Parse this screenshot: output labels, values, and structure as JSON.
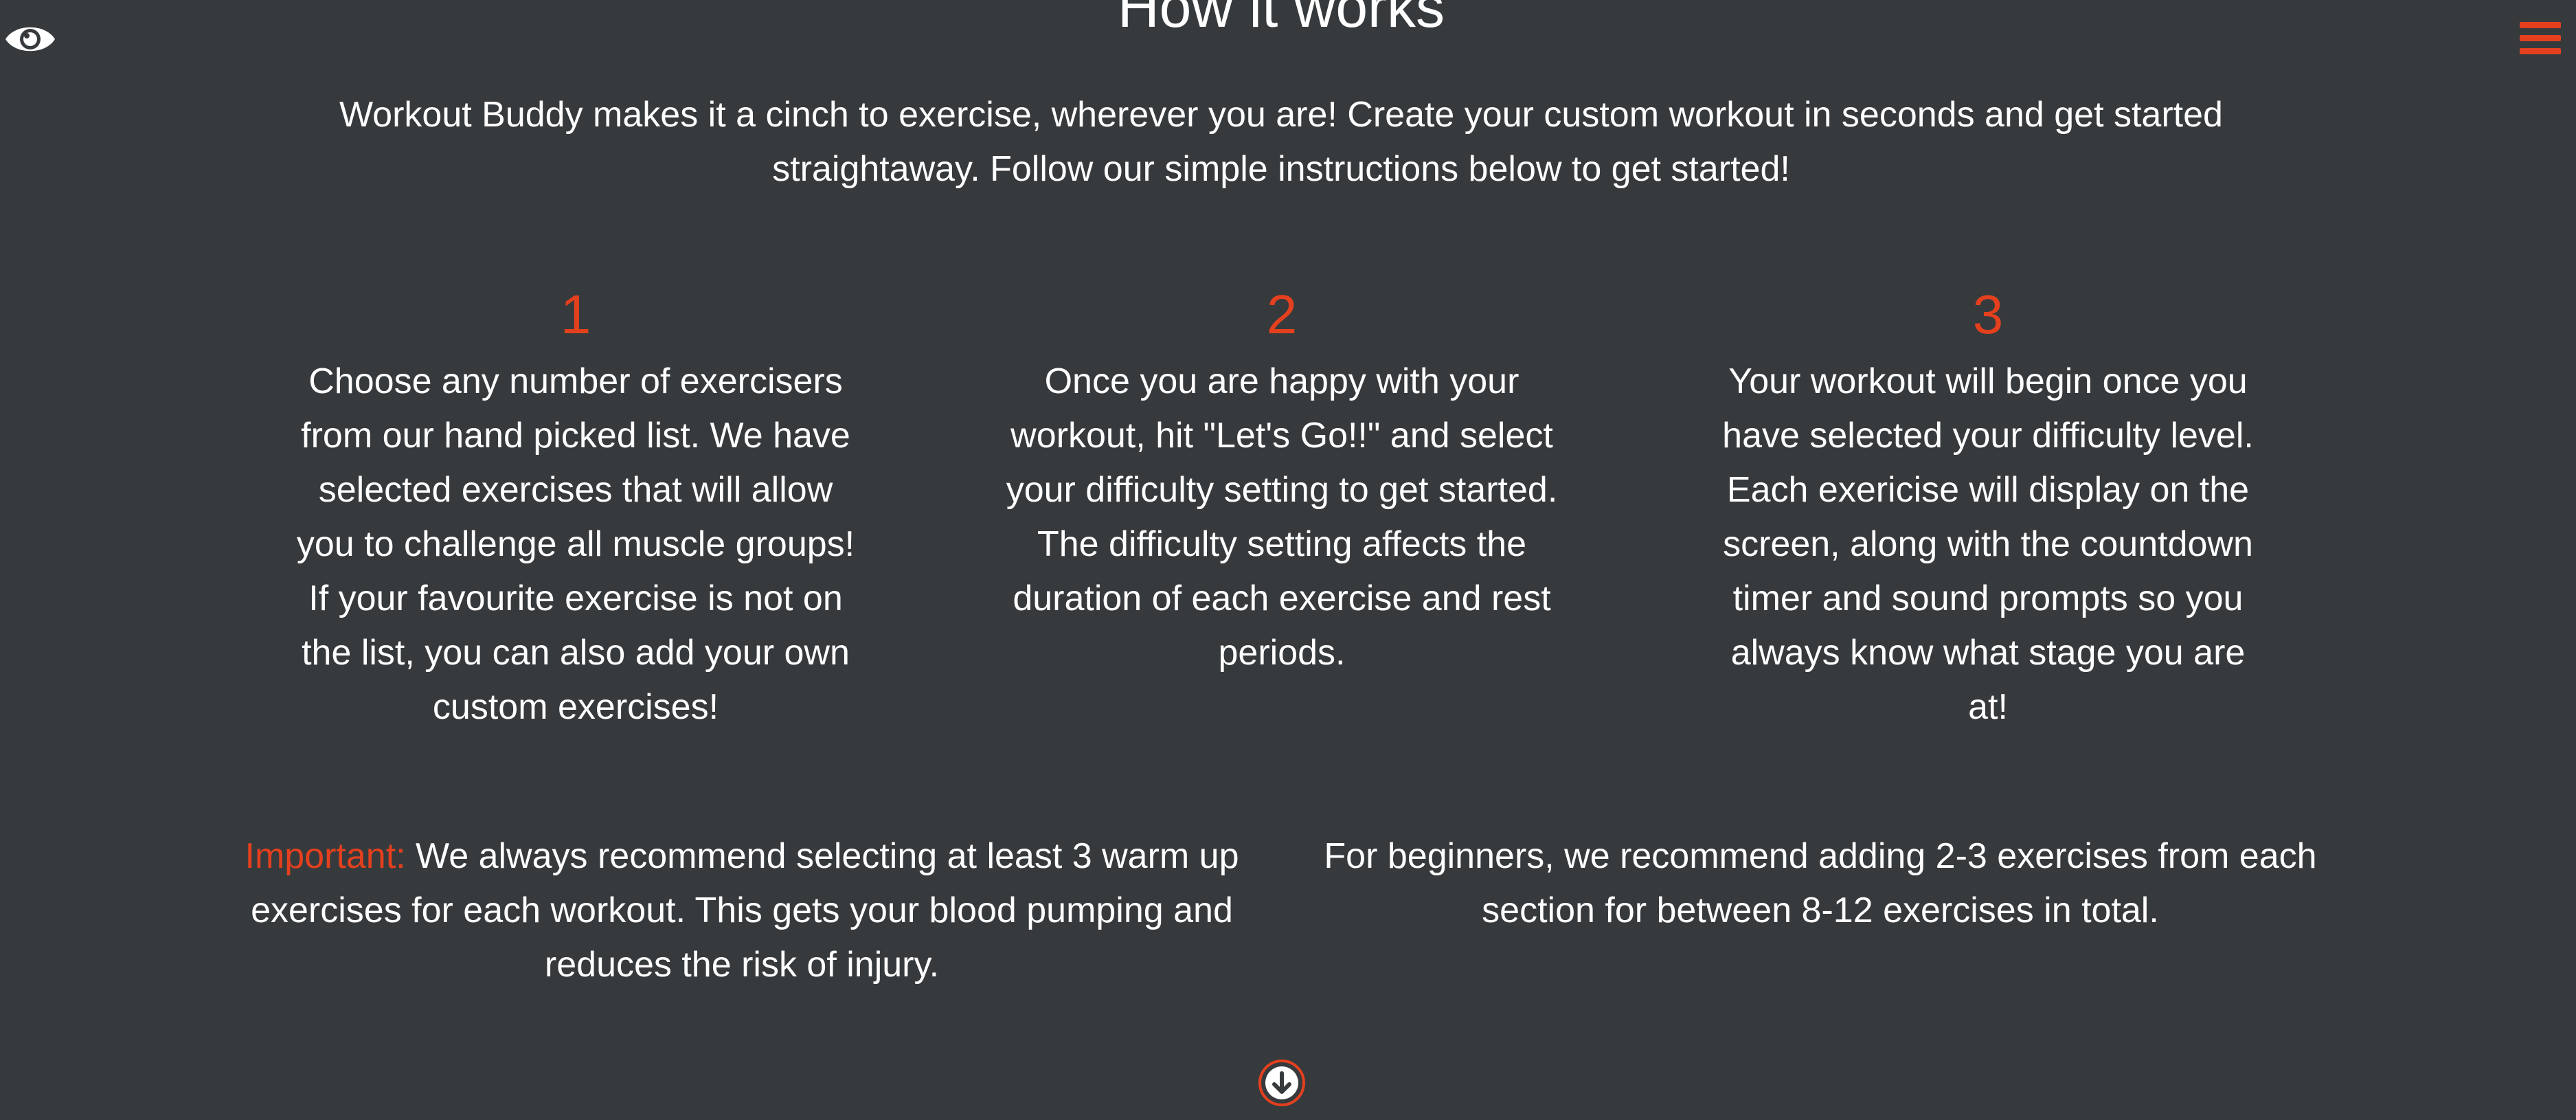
{
  "header": {
    "eye_icon": "eye-icon",
    "menu_icon": "hamburger-menu-icon"
  },
  "section": {
    "title": "How it works",
    "intro": "Workout Buddy makes it a cinch to exercise, wherever you are! Create your custom workout in seconds and get started straightaway. Follow our simple instructions below to get started!"
  },
  "steps": [
    {
      "number": "1",
      "text": "Choose any number of exercisers from our hand picked list. We have selected exercises that will allow you to challenge all muscle groups! If your favourite exercise is not on the list, you can also add your own custom exercises!"
    },
    {
      "number": "2",
      "text": "Once you are happy with your workout, hit \"Let's Go!!\" and select your difficulty setting to get started. The difficulty setting affects the duration of each exercise and rest periods."
    },
    {
      "number": "3",
      "text": "Your workout will begin once you have selected your difficulty level. Each exericise will display on the screen, along with the countdown timer and sound prompts so you always know what stage you are at!"
    }
  ],
  "notes": {
    "important_label": "Important:",
    "important_text": " We always recommend selecting at least 3 warm up exercises for each workout. This gets your blood pumping and reduces the risk of injury.",
    "beginners_text": "For beginners, we recommend adding 2-3 exercises from each section for between 8-12 exercises in total."
  },
  "scroll": {
    "icon": "arrow-down-circle-icon"
  },
  "colors": {
    "background": "#363a3d",
    "accent": "#e4401e",
    "text": "#ffffff"
  }
}
